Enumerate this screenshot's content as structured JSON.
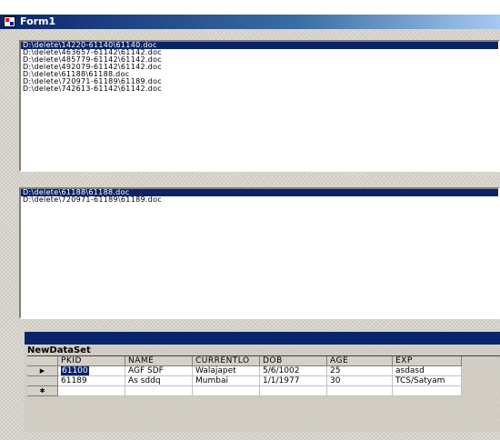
{
  "window": {
    "title": "Form1"
  },
  "listbox1": {
    "items": [
      "D:\\delete\\14220-61140\\61140.doc",
      "D:\\delete\\463657-61142\\61142.doc",
      "D:\\delete\\485779-61142\\61142.doc",
      "D:\\delete\\492079-61142\\61142.doc",
      "D:\\delete\\61188\\61188.doc",
      "D:\\delete\\720971-61189\\61189.doc",
      "D:\\delete\\742613-61142\\61142.doc"
    ],
    "selected_index": 0
  },
  "listbox2": {
    "items": [
      "D:\\delete\\61188\\61188.doc",
      "D:\\delete\\720971-61189\\61189.doc"
    ],
    "selected_index": 0
  },
  "datagrid": {
    "caption": "NewDataSet",
    "columns": [
      "PKID",
      "NAME",
      "CURRENTLO",
      "DOB",
      "AGE",
      "EXP"
    ],
    "rows": [
      [
        "61100",
        "AGF SDF",
        "Walajapet",
        "5/6/1002",
        "25",
        "asdasd"
      ],
      [
        "61189",
        "As sddq",
        "Mumbai",
        "1/1/1977",
        "30",
        "TCS/Satyam"
      ]
    ],
    "current_row_indicator": "▶",
    "new_row_indicator": "✱"
  },
  "colors": {
    "title_bar": "#0a246a",
    "selection": "#0a246a",
    "face": "#d4d0c8"
  }
}
